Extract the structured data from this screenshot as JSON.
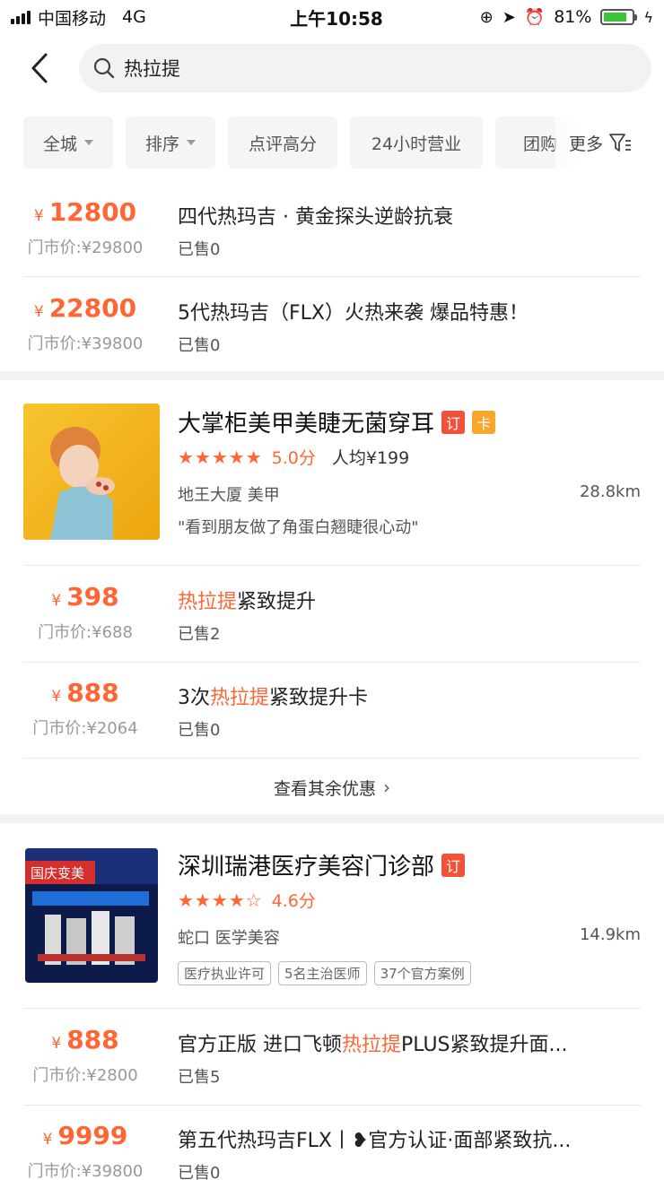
{
  "status": {
    "carrier": "中国移动",
    "network": "4G",
    "time": "上午10:58",
    "battery": "81%",
    "battery_level": 0.81
  },
  "search": {
    "query": "热拉提"
  },
  "filters": {
    "items": [
      "全城",
      "排序",
      "点评高分",
      "24小时营业",
      "团购"
    ],
    "more": "更多"
  },
  "top_deals": [
    {
      "currency": "¥",
      "price": "12800",
      "original": "门市价:¥29800",
      "title": "四代热玛吉 · 黄金探头逆龄抗衰",
      "sold": "已售0"
    },
    {
      "currency": "¥",
      "price": "22800",
      "original": "门市价:¥39800",
      "title": "5代热玛吉（FLX）火热来袭 爆品特惠！",
      "sold": "已售0"
    }
  ],
  "shop1": {
    "name": "大掌柜美甲美睫无菌穿耳",
    "tag1": "订",
    "tag2": "卡",
    "stars": "★★★★★",
    "score": "5.0分",
    "avg": "人均¥199",
    "area": "地王大厦  美甲",
    "distance": "28.8km",
    "quote": "\"看到朋友做了角蛋白翘睫很心动\"",
    "deals": [
      {
        "currency": "¥",
        "price": "398",
        "original": "门市价:¥688",
        "title_pre": "",
        "title_hl": "热拉提",
        "title_post": "紧致提升",
        "sold": "已售2"
      },
      {
        "currency": "¥",
        "price": "888",
        "original": "门市价:¥2064",
        "title_pre": "3次",
        "title_hl": "热拉提",
        "title_post": "紧致提升卡",
        "sold": "已售0"
      }
    ],
    "more": "查看其余优惠"
  },
  "shop2": {
    "name": "深圳瑞港医疗美容门诊部",
    "tag1": "订",
    "stars": "★★★★☆",
    "score": "4.6分",
    "area": "蛇口  医学美容",
    "distance": "14.9km",
    "badges": [
      "医疗执业许可",
      "5名主治医师",
      "37个官方案例"
    ],
    "image_text": "国庆变美",
    "deals": [
      {
        "currency": "¥",
        "price": "888",
        "original": "门市价:¥2800",
        "title_pre": "官方正版 进口飞顿",
        "title_hl": "热拉提",
        "title_post": "PLUS紧致提升面...",
        "sold": "已售5"
      },
      {
        "currency": "¥",
        "price": "9999",
        "original": "门市价:¥39800",
        "title_pre": "第五代热玛吉FLX丨❥官方认证·面部紧致抗...",
        "title_hl": "",
        "title_post": "",
        "sold": "已售0"
      }
    ]
  }
}
